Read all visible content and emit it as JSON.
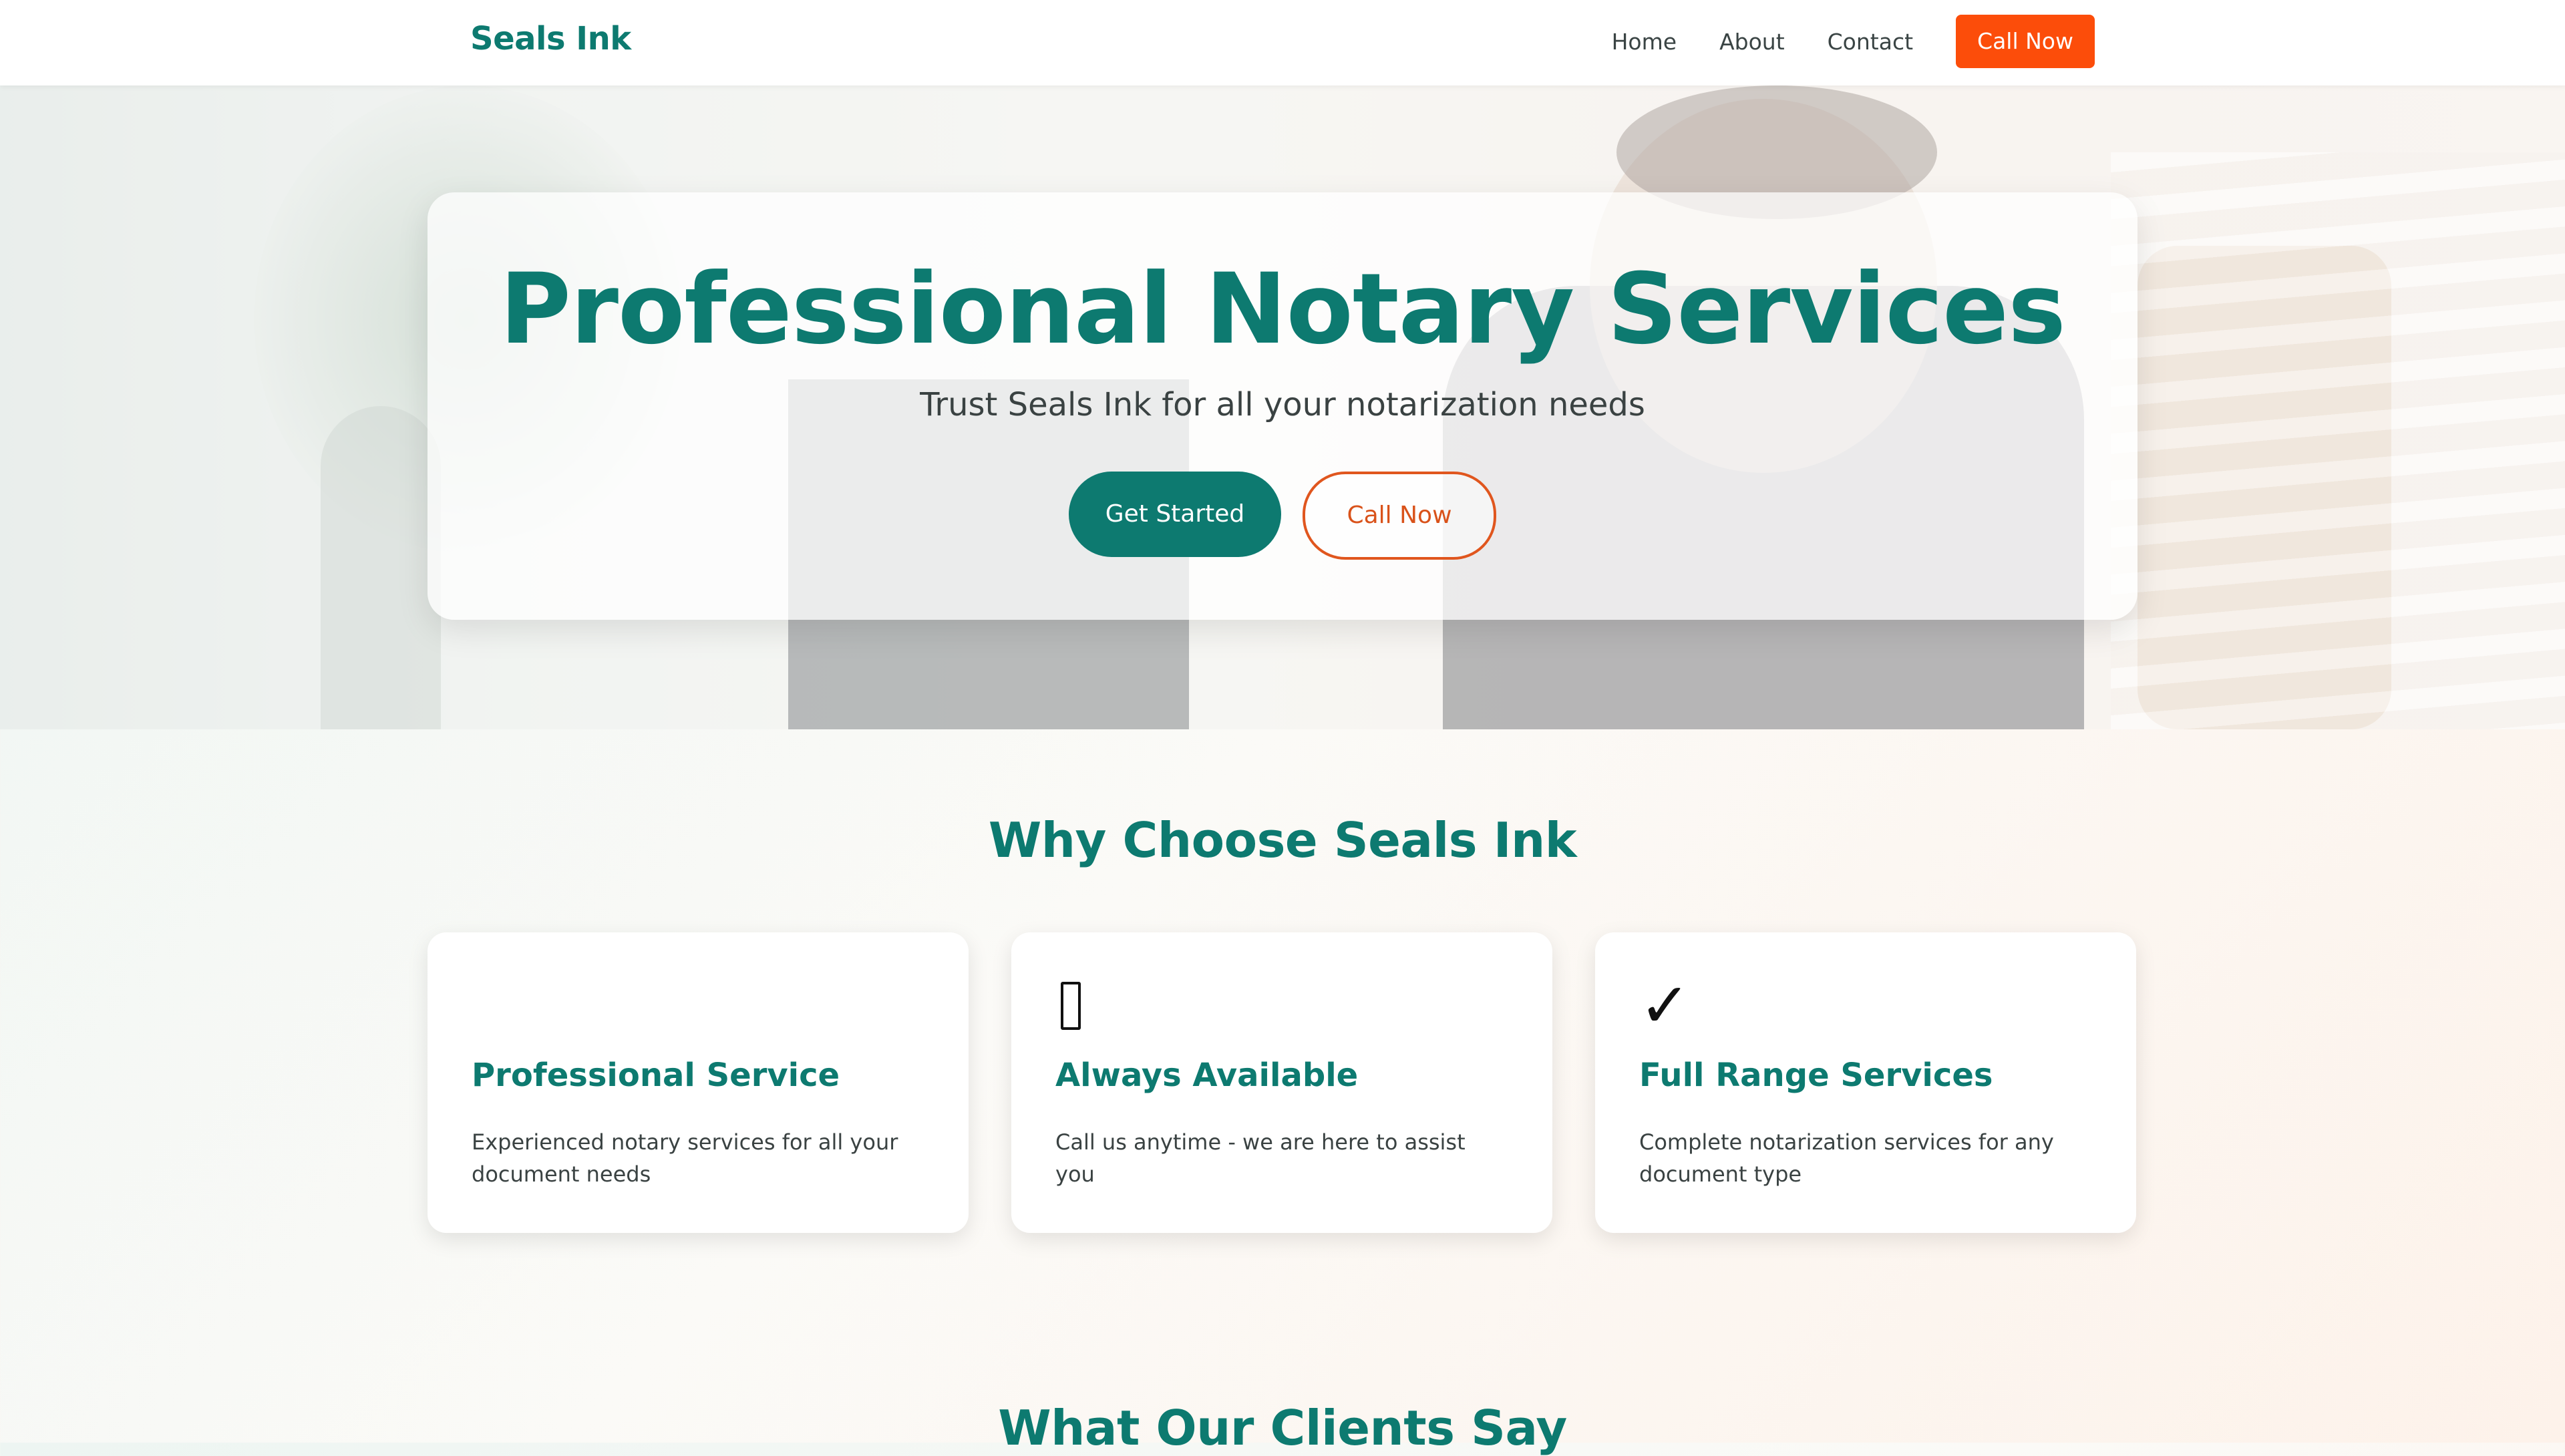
{
  "nav": {
    "brand": "Seals Ink",
    "links": [
      "Home",
      "About",
      "Contact"
    ],
    "cta": "Call Now"
  },
  "hero": {
    "title": "Professional Notary Services",
    "subtitle": "Trust Seals Ink for all your notarization needs",
    "primary_button": "Get Started",
    "secondary_button": "Call Now"
  },
  "features": {
    "title": "Why Choose Seals Ink",
    "cards": [
      {
        "icon": "",
        "icon_name": "blank-icon",
        "title": "Professional Service",
        "desc": "Experienced notary services for all your document needs"
      },
      {
        "icon": "",
        "icon_name": "phone-icon",
        "title": "Always Available",
        "desc": "Call us anytime - we are here to assist you"
      },
      {
        "icon": "✓",
        "icon_name": "checkmark-icon",
        "title": "Full Range Services",
        "desc": "Complete notarization services for any document type"
      }
    ]
  },
  "testimonials": {
    "title": "What Our Clients Say"
  },
  "colors": {
    "brand": "#0d7a70",
    "accent": "#fc4d0a"
  }
}
